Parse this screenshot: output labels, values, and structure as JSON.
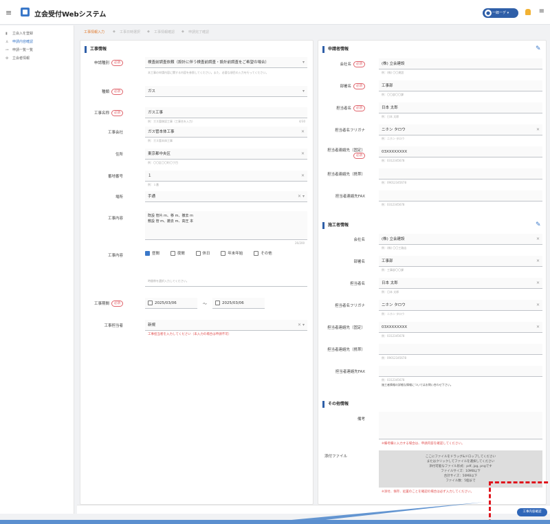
{
  "header": {
    "title": "立会受付Webシステム",
    "user_label": "一郎ーデ"
  },
  "sidebar": {
    "items": [
      {
        "icon": "building-icon",
        "label": "立会入を登録",
        "active": false
      },
      {
        "icon": "person-icon",
        "label": "申請内容確認",
        "active": true
      },
      {
        "icon": "list-icon",
        "label": "申請一覧一覧",
        "active": false
      },
      {
        "icon": "settings-icon",
        "label": "立会者情報",
        "active": false
      }
    ]
  },
  "steps": [
    "工事情報入力",
    "工事日時選択",
    "工事情報確認",
    "申請完了確認"
  ],
  "left": {
    "section": "工事情報",
    "req": "必須",
    "kind": {
      "label": "申請種別",
      "value": "検査前調査依頼（設計に伴う検査前調査・設計前調査をご希望の場合）",
      "help": "本工事の申請内容に関する内容を参照してください。また、必要な項目の入力を行ってください。"
    },
    "type": {
      "label": "種類",
      "value": "ガス"
    },
    "name": {
      "label": "工事名称",
      "value": "ガス工事",
      "hint": "例：ガス管移設工事（工事名を入力）"
    },
    "company": {
      "label": "工事会社",
      "value": "ガス管本体工事",
      "hint": "例：ガス管本体工事"
    },
    "address": {
      "label": "住所",
      "value": "東京都中央区",
      "hint": "例：〇〇区〇〇町〇丁目"
    },
    "number": {
      "label": "番地番号",
      "value": "１",
      "hint": "例：１番"
    },
    "place": {
      "label": "場所",
      "value": "手通"
    },
    "detail": {
      "label": "工事内容",
      "value": "既設 管片 m、移 m、撤去 m\n敷設 管 m、撤去 m、高圧 本"
    },
    "period": {
      "label": "工事内容",
      "options": [
        "昼間",
        "夜間",
        "休日",
        "年末年始",
        "その他"
      ],
      "hint": "時間帯を選択入力してください。"
    },
    "dates": {
      "label": "工事期間",
      "from": "2025/03/06",
      "to": "2025/03/06"
    },
    "crew": {
      "label": "工事担当者",
      "value": "新規",
      "error": "工事担当者を入力してください（未入力の場合は申請不可）"
    }
  },
  "right": {
    "client": {
      "section": "申請者情報",
      "company": {
        "label": "会社名",
        "value": "(株) 立会建設",
        "hint": "例：(株) 〇〇建設"
      },
      "dept": {
        "label": "部署名",
        "value": "工事部",
        "hint": "例：〇〇部〇〇課"
      },
      "person": {
        "label": "担当者名",
        "value": "日本 太郎",
        "hint": "例：日本 太郎"
      },
      "kana": {
        "label": "担当者名フリガナ",
        "value": "ニホン タロウ",
        "hint": "例：ニホン タロウ"
      },
      "phone": {
        "label": "担当者連絡先（固定）",
        "value": "03XXXXXXXX",
        "hint": "例：0312345678"
      },
      "mobile": {
        "label": "担当者連絡先（携帯）",
        "value": "",
        "hint": "例：09012345678"
      },
      "fax": {
        "label": "担当者連絡先FAX",
        "value": "",
        "hint": "例：0312345678"
      }
    },
    "builder": {
      "section": "施工者情報",
      "company": {
        "label": "会社名",
        "value": "(株) 立会建設",
        "hint": "例：(株) 〇〇工務店"
      },
      "dept": {
        "label": "部署名",
        "value": "工事部",
        "hint": "例：工事部〇〇課"
      },
      "person": {
        "label": "担当者名",
        "value": "日本 太郎",
        "hint": "例：日本 太郎"
      },
      "kana": {
        "label": "担当者名フリガナ",
        "value": "ニホン タロウ",
        "hint": "例：ニホン タロウ"
      },
      "phone": {
        "label": "担当者連絡先（固定）",
        "value": "03XXXXXXXX",
        "hint": "例：0312345678"
      },
      "mobile": {
        "label": "担当者連絡先（携帯）",
        "value": "",
        "hint": "例：09012345678"
      },
      "fax": {
        "label": "担当者連絡先FAX",
        "value": "",
        "hint": "例：0312345678"
      },
      "note": "施工者情報の詳細な情報についてはお問い合わせ下さい。"
    },
    "other": {
      "section": "その他情報",
      "memo": {
        "label": "備考",
        "value": "",
        "hint": "※備考欄に入力する場合は、申請内容を確認してください。"
      },
      "attach": {
        "label": "添付ファイル",
        "drop": "ここにファイルをドラッグ&ドロップしてください\nまたはクリックしてファイルを選択してください\n添付可能なファイル形式：pdf, jpg, pngです\nファイルサイズ：10MB以下\n合計サイズ：50MB以下\nファイル数：5個まで",
        "note": "※添付、保存、処置のことを確認の場合は必ず入力してください。"
      }
    }
  },
  "submit": "工事内容確認"
}
